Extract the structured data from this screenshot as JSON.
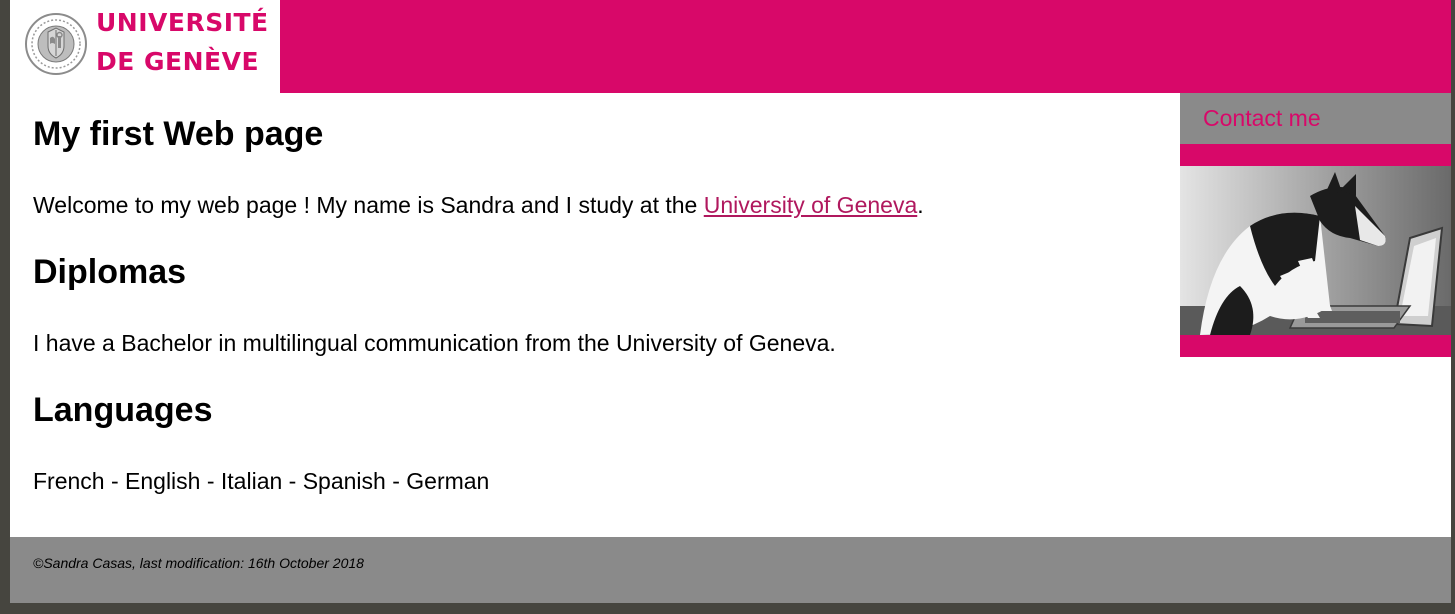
{
  "header": {
    "logo": {
      "line1": "UNIVERSITÉ",
      "line2": "DE GENÈVE",
      "seal_icon": "university-seal-icon"
    },
    "color": "#d80869"
  },
  "main": {
    "title": "My first Web page",
    "welcome": {
      "before": "Welcome to my web page ! My name is Sandra and I study at the ",
      "link": "University of Geneva",
      "after": "."
    },
    "sections": [
      {
        "heading": "Diplomas",
        "text": "I have a Bachelor in multilingual communication from the University of Geneva."
      },
      {
        "heading": "Languages",
        "text": "French - English - Italian - Spanish - German"
      }
    ]
  },
  "sidebar": {
    "contact_label": "Contact me",
    "photo_icon": "dog-at-laptop-photo"
  },
  "footer": {
    "text": "©Sandra Casas, last modification: 16th October 2018"
  },
  "colors": {
    "accent": "#d80869",
    "link": "#b0185e",
    "gray": "#8a8a8a",
    "frame": "#46453f"
  }
}
